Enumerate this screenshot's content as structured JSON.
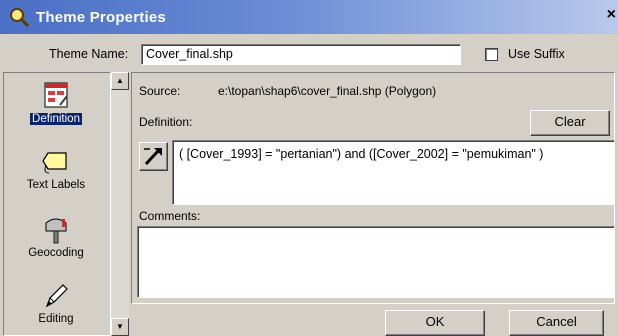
{
  "window": {
    "title": "Theme Properties",
    "close_glyph": "×",
    "icon": "magnifier-icon"
  },
  "theme_name": {
    "label": "Theme Name:",
    "value": "Cover_final.shp"
  },
  "use_suffix": {
    "label": "Use Suffix",
    "checked": false
  },
  "sidebar": {
    "items": [
      {
        "label": "Definition",
        "icon": "definition-icon",
        "selected": true
      },
      {
        "label": "Text Labels",
        "icon": "text-label-icon",
        "selected": false
      },
      {
        "label": "Geocoding",
        "icon": "geocoding-icon",
        "selected": false
      },
      {
        "label": "Editing",
        "icon": "editing-icon",
        "selected": false
      }
    ]
  },
  "source": {
    "label": "Source:",
    "value": "e:\\topan\\shap6\\cover_final.shp (Polygon)"
  },
  "definition": {
    "label": "Definition:",
    "clear_label": "Clear",
    "query_icon": "query-builder-icon",
    "expression": "( [Cover_1993] = \"pertanian\") and ([Cover_2002] = \"pemukiman\" )"
  },
  "comments": {
    "label": "Comments:",
    "value": ""
  },
  "buttons": {
    "ok": "OK",
    "cancel": "Cancel"
  },
  "colors": {
    "titlebar": "#4a6fc4",
    "dialog": "#d4d0c8",
    "selection": "#0a246a"
  }
}
